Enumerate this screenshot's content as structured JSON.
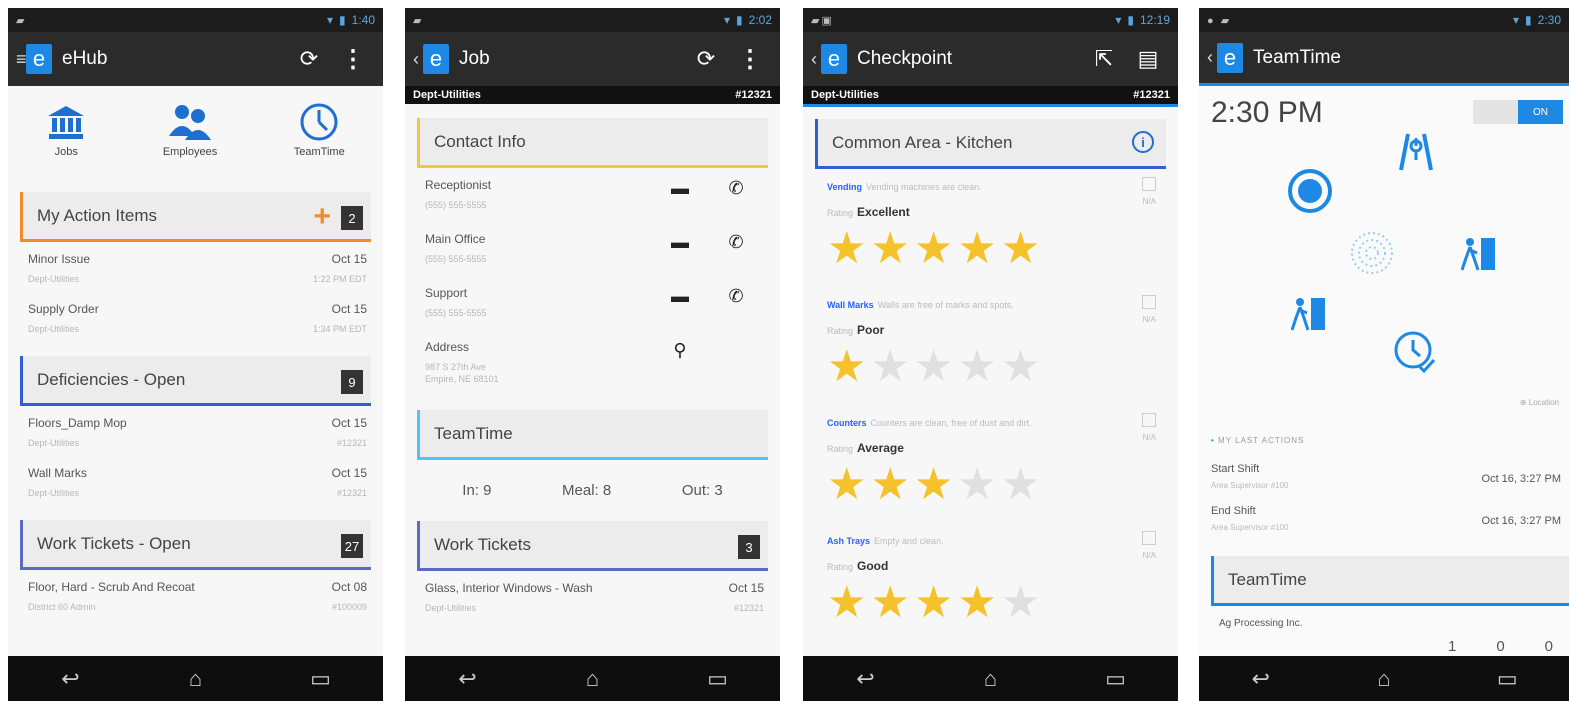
{
  "colors": {
    "accent_blue": "#1e88e5",
    "accent_orange": "#f28c28",
    "star_gold": "#f5c22b",
    "section_purple": "#5c6bc0",
    "section_yellow": "#f6c342",
    "section_lightblue": "#4fc3f7"
  },
  "screens": [
    {
      "status_time": "1:40",
      "title": "eHub",
      "icons": [
        {
          "label": "Jobs",
          "icon": "bank-icon"
        },
        {
          "label": "Employees",
          "icon": "people-icon"
        },
        {
          "label": "TeamTime",
          "icon": "clock-icon"
        }
      ],
      "sections": [
        {
          "title": "My Action Items",
          "badge": "2",
          "rows": [
            {
              "name": "Minor Issue",
              "sub": "Dept-Utilities",
              "date": "Oct 15",
              "sub_right": "1:22 PM EDT"
            },
            {
              "name": "Supply Order",
              "sub": "Dept-Utilities",
              "date": "Oct 15",
              "sub_right": "1:34 PM EDT"
            }
          ]
        },
        {
          "title": "Deficiencies - Open",
          "badge": "9",
          "rows": [
            {
              "name": "Floors_Damp Mop",
              "sub": "Dept-Utilities",
              "date": "Oct 15",
              "sub_right": "#12321"
            },
            {
              "name": "Wall Marks",
              "sub": "Dept-Utilities",
              "date": "Oct 15",
              "sub_right": "#12321"
            }
          ]
        },
        {
          "title": "Work Tickets - Open",
          "badge": "27",
          "rows": [
            {
              "name": "Floor, Hard - Scrub And Recoat",
              "sub": "District 60 Admin",
              "date": "Oct 08",
              "sub_right": "#100009"
            }
          ]
        }
      ]
    },
    {
      "status_time": "2:02",
      "title": "Job",
      "dept": "Dept-Utilities",
      "job_no": "#12321",
      "contact_title": "Contact Info",
      "contacts": [
        {
          "name": "Receptionist",
          "sub": "(555) 555-5555"
        },
        {
          "name": "Main Office",
          "sub": "(555) 555-5555"
        },
        {
          "name": "Support",
          "sub": "(555) 555-5555"
        }
      ],
      "address_label": "Address",
      "address_line1": "987 S 27th Ave",
      "address_line2": "Empire, NE 68101",
      "teamtime_title": "TeamTime",
      "tt_in": "In: 9",
      "tt_meal": "Meal: 8",
      "tt_out": "Out: 3",
      "wt_title": "Work Tickets",
      "wt_badge": "3",
      "wt_rows": [
        {
          "name": "Glass, Interior Windows - Wash",
          "sub": "Dept-Utilities",
          "date": "Oct 15",
          "sub_right": "#12321"
        }
      ]
    },
    {
      "status_time": "12:19",
      "title": "Checkpoint",
      "dept": "Dept-Utilities",
      "job_no": "#12321",
      "area_title": "Common Area  - Kitchen",
      "rating_label": "Rating",
      "na_label": "N/A",
      "items": [
        {
          "name": "Vending",
          "desc": "Vending machines are clean.",
          "rating": "Excellent",
          "stars": 5
        },
        {
          "name": "Wall Marks",
          "desc": "Walls are free of marks and spots.",
          "rating": "Poor",
          "stars": 1
        },
        {
          "name": "Counters",
          "desc": "Counters are clean, free of dust and dirt.",
          "rating": "Average",
          "stars": 3
        },
        {
          "name": "Ash Trays",
          "desc": "Empty and clean.",
          "rating": "Good",
          "stars": 4
        }
      ]
    },
    {
      "status_time": "2:30",
      "title": "TeamTime",
      "clock": "2:30 PM",
      "toggle_on": "ON",
      "location_label": "Location",
      "last_actions_title": "MY LAST ACTIONS",
      "last_actions": [
        {
          "name": "Start Shift",
          "sub": "Area Supervisor #100",
          "date": "Oct 16, 3:27 PM"
        },
        {
          "name": "End Shift",
          "sub": "Area Supervisor #100",
          "date": "Oct 16, 3:27 PM"
        }
      ],
      "section_title": "TeamTime",
      "company": "Ag Processing Inc.",
      "counts": [
        "1",
        "0",
        "0"
      ]
    }
  ]
}
